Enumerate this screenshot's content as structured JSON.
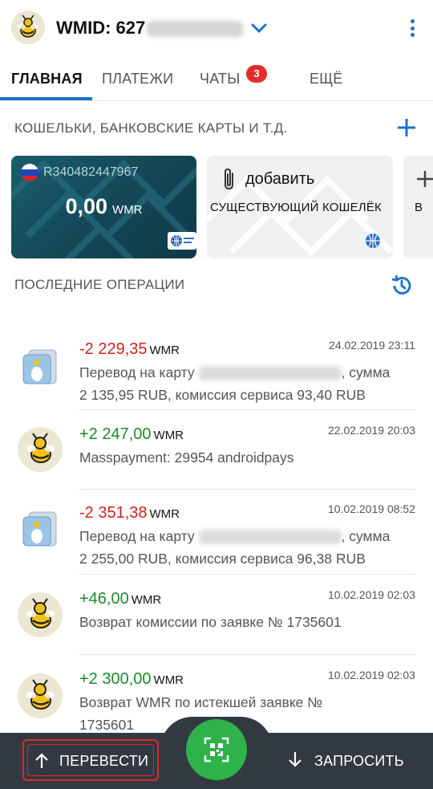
{
  "header": {
    "wmid_label": "WMID: 627",
    "colors": {
      "accent": "#1a73c9"
    }
  },
  "tabs": [
    {
      "label": "ГЛАВНАЯ"
    },
    {
      "label": "ПЛАТЕЖИ"
    },
    {
      "label": "ЧАТЫ",
      "badge": "3"
    },
    {
      "label": "ЕЩЁ"
    }
  ],
  "wallets": {
    "section_title": "КОШЕЛЬКИ, БАНКОВСКИЕ КАРТЫ И Т.Д.",
    "purse": {
      "number": "R340482447967",
      "amount": "0,00",
      "currency": "WMR"
    },
    "add_card": {
      "title": "добавить",
      "subtitle": "СУЩЕСТВУЮЩИЙ КОШЕЛЁК"
    },
    "partial_card_text": "В"
  },
  "operations": {
    "section_title": "ПОСЛЕДНИЕ ОПЕРАЦИИ",
    "items": [
      {
        "amount": "-2 229,35",
        "unit": "WMR",
        "date": "24.02.2019 23:11",
        "line1_pre": "Перевод на карту",
        "line1_post": ", сумма",
        "line2": "2 135,95 RUB, комиссия сервиса 93,40 RUB"
      },
      {
        "amount": "+2 247,00",
        "unit": "WMR",
        "date": "22.02.2019 20:03",
        "line1": "Masspayment: 29954 androidpays"
      },
      {
        "amount": "-2 351,38",
        "unit": "WMR",
        "date": "10.02.2019 08:52",
        "line1_pre": "Перевод на карту",
        "line1_post": ", сумма",
        "line2": "2 255,00 RUB, комиссия сервиса 96,38 RUB"
      },
      {
        "amount": "+46,00",
        "unit": "WMR",
        "date": "10.02.2019 02:03",
        "line1": "Возврат комиссии по заявке  № 1735601"
      },
      {
        "amount": "+2 300,00",
        "unit": "WMR",
        "date": "10.02.2019 02:03",
        "line1": "Возврат WMR по истекшей заявке №",
        "line2": "1735601"
      }
    ]
  },
  "bottom_bar": {
    "send_label": "ПЕРЕВЕСТИ",
    "request_label": "ЗАПРОСИТЬ",
    "qr_icon": "qr-code-icon"
  }
}
